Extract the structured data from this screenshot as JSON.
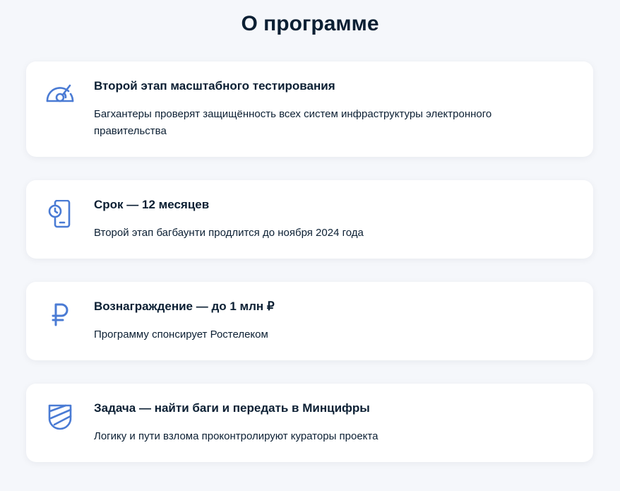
{
  "page": {
    "title": "О программе"
  },
  "colors": {
    "accent": "#4a7bd4",
    "card_background": "#ffffff",
    "page_background": "#f5f7fb",
    "text": "#0b1f33"
  },
  "cards": [
    {
      "icon": "speedometer-icon",
      "title": "Второй этап масштабного тестирования",
      "description": "Багхантеры проверят защищённость всех систем инфраструктуры электронного правительства"
    },
    {
      "icon": "phone-clock-icon",
      "title": "Срок — 12 месяцев",
      "description": "Второй этап багбаунти продлится до ноября 2024 года"
    },
    {
      "icon": "ruble-icon",
      "title": "Вознаграждение — до 1 млн ₽",
      "description": "Программу спонсирует Ростелеком"
    },
    {
      "icon": "shield-icon",
      "title": "Задача — найти баги и передать в Минцифры",
      "description": "Логику и пути взлома проконтролируют кураторы проекта"
    }
  ]
}
